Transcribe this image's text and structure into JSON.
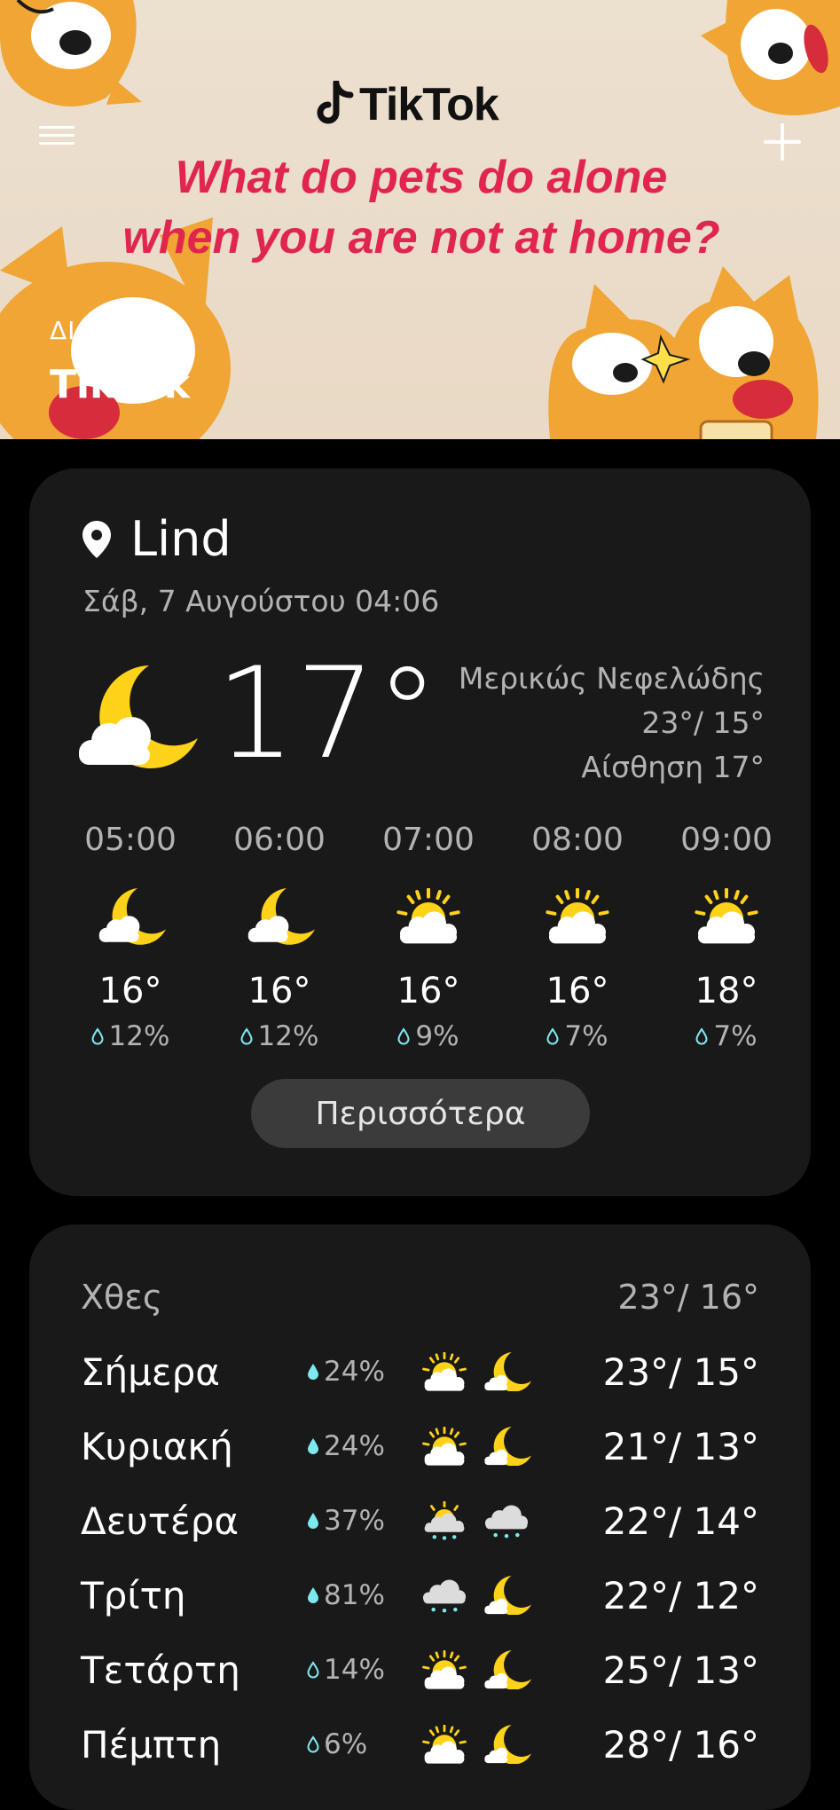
{
  "ad": {
    "brand_logo_text": "TikTok",
    "headline_line1": "What do pets do alone",
    "headline_line2": "when you are not at home?",
    "label": "ΔΙΑΦΗΜ.",
    "advertiser": "TikTok"
  },
  "current": {
    "location": "Lind",
    "datetime": "Σάβ, 7 Αυγούστου 04:06",
    "temperature": "17°",
    "condition": "Μερικώς Νεφελώδης",
    "high_low": "23°/ 15°",
    "feels_like": "Αίσθηση 17°",
    "icon": "moon-cloud-icon"
  },
  "hourly": [
    {
      "time": "05:00",
      "icon": "moon-cloud-icon",
      "temp": "16°",
      "precip": "12%"
    },
    {
      "time": "06:00",
      "icon": "moon-cloud-icon",
      "temp": "16°",
      "precip": "12%"
    },
    {
      "time": "07:00",
      "icon": "sun-cloud-icon",
      "temp": "16°",
      "precip": "9%"
    },
    {
      "time": "08:00",
      "icon": "sun-cloud-icon",
      "temp": "16°",
      "precip": "7%"
    },
    {
      "time": "09:00",
      "icon": "sun-cloud-icon",
      "temp": "18°",
      "precip": "7%"
    }
  ],
  "more_label": "Περισσότερα",
  "yesterday": {
    "label": "Χθες",
    "temps": "23°/ 16°"
  },
  "daily": [
    {
      "day": "Σήμερα",
      "precip": "24%",
      "day_icon": "sun-cloud-icon",
      "night_icon": "moon-icon",
      "temps": "23°/ 15°"
    },
    {
      "day": "Κυριακή",
      "precip": "24%",
      "day_icon": "sun-cloud-icon",
      "night_icon": "moon-icon",
      "temps": "21°/ 13°"
    },
    {
      "day": "Δευτέρα",
      "precip": "37%",
      "day_icon": "sun-rain-icon",
      "night_icon": "rain-cloud-icon",
      "temps": "22°/ 14°"
    },
    {
      "day": "Τρίτη",
      "precip": "81%",
      "day_icon": "rain-cloud-icon",
      "night_icon": "moon-icon",
      "temps": "22°/ 12°"
    },
    {
      "day": "Τετάρτη",
      "precip": "14%",
      "day_icon": "sun-cloud-icon",
      "night_icon": "moon-icon",
      "temps": "25°/ 13°"
    },
    {
      "day": "Πέμπτη",
      "precip": "6%",
      "day_icon": "sun-cloud-icon",
      "night_icon": "moon-icon",
      "temps": "28°/ 16°"
    }
  ],
  "colors": {
    "accent_yellow": "#ffd21a",
    "headline_red": "#e0254e",
    "card_bg": "#191919",
    "drop": "#7ee8f0"
  }
}
